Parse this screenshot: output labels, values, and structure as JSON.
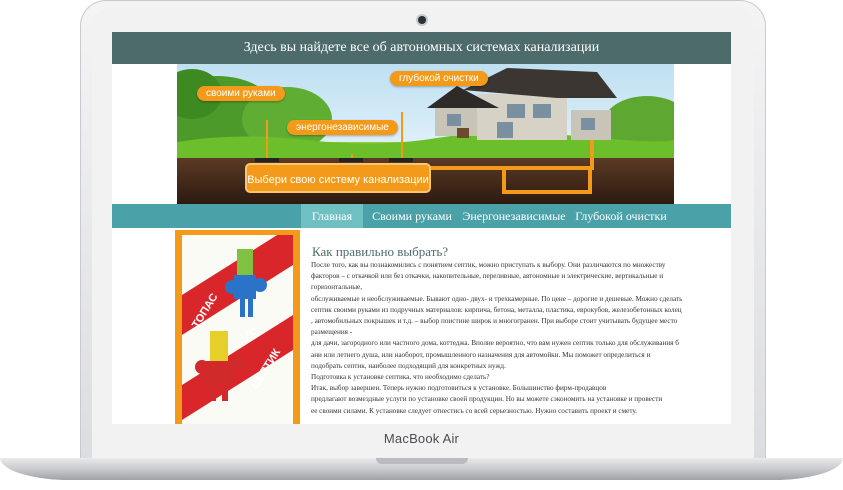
{
  "device": {
    "brand_label": "MacBook Air"
  },
  "site": {
    "header_title": "Здесь вы найдете все об автономных системах канализации",
    "banner": {
      "callouts": [
        "своими руками",
        "глубокой очистки",
        "энергонезависимые"
      ],
      "cta": "Выбери свою систему канализации"
    },
    "nav": {
      "items": [
        "Главная",
        "Своими руками",
        "Энергонезависимые",
        "Глубокой очистки"
      ],
      "active": "Главная"
    },
    "sidebar_promo": {
      "text_left": "ТОПАС",
      "text_vs": "VS",
      "text_right": "СЕПТИК"
    },
    "article": {
      "title": "Как правильно выбрать?",
      "lines": [
        "После того, как вы познакомились с понятием септик, можно приступать к выбору. Они различаются по множеству",
        "факторов – с откачкой или без откачки, накопительные, переливные, автономные и электрические, вертикальные и",
        "горизонтальные,",
        " обслуживаемые и необслуживаемые. Бывают одно- двух- и трехкамерные. По цене – дорогие и дешевые. Можно сделать",
        " септик своими руками из подручных материалов: кирпича, бетона, металла, пластика, еврокубов, железобетонных колец",
        ", автомобильных покрышек и т.д. – выбор поистине широк и многогранен. При выборе стоит учитывать будущее место",
        "размещения -",
        "для дачи, загородного или частного дома, коттеджа. Вполне вероятно, что вам нужен септик только для обслуживания б",
        "ани или летнего душа, или наоборот, промышленного назначения для автомойки. Мы поможет определиться и",
        " подобрать септик, наиболее подходящий для конкретных нужд.",
        "Подготовка к установке септика, что необходимо сделать?",
        "Итак, выбор завершен. Теперь нужно подготовиться к установке. Большинство фирм-продавцов",
        "предлагают возмездные услуги по установке своей продукции. Но вы можете сэкономить на установке и провести",
        " ее своими силами. К установке следует отнестись со всей серьезностью. Нужно составить проект и смету."
      ]
    }
  },
  "colors": {
    "header_bg": "#4d6b6a",
    "nav_bg": "#4aa2a8",
    "nav_active_bg": "#6fc0c3",
    "accent_orange": "#f39a1b"
  }
}
